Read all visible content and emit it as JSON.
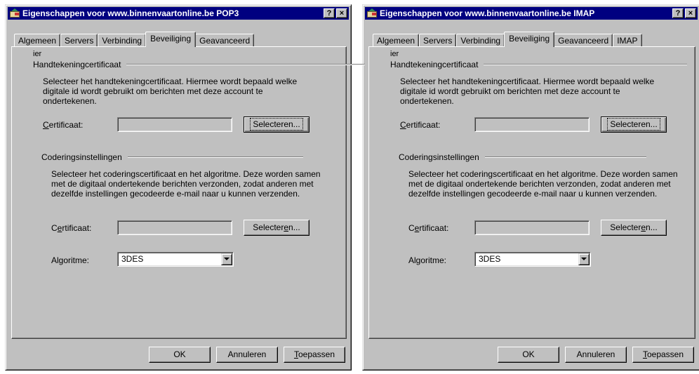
{
  "dialogs": [
    {
      "title": "Eigenschappen voor www.binnenvaartonline.be POP3",
      "title_buttons": [
        "?",
        "×"
      ],
      "tabs": [
        "Algemeen",
        "Servers",
        "Verbinding",
        "Beveiliging",
        "Geavanceerd"
      ],
      "active_tab": "Beveiliging",
      "stray_text": "ier",
      "signing": {
        "group_title": "Handtekeningcertificaat",
        "description": "Selecteer het handtekeningcertificaat. Hiermee wordt bepaald welke digitale id wordt gebruikt om berichten met deze account te ondertekenen.",
        "cert_label_u": "C",
        "cert_label_rest": "ertificaat:",
        "cert_value": "",
        "select_button": "Selecteren..."
      },
      "encryption": {
        "group_title": "Coderingsinstellingen",
        "description": "Selecteer het coderingscertificaat en het algoritme. Deze worden samen met de digitaal ondertekende berichten verzonden, zodat anderen met dezelfde instellingen gecodeerde e-mail naar u kunnen verzenden.",
        "cert_label_a": "C",
        "cert_label_u": "e",
        "cert_label_rest": "rtificaat:",
        "cert_value": "",
        "select_button_a": "Selecter",
        "select_button_u": "e",
        "select_button_rest": "n...",
        "algorithm_label": "Algoritme:",
        "algorithm_value": "3DES"
      },
      "buttons": {
        "ok": "OK",
        "cancel": "Annuleren",
        "apply_u": "T",
        "apply_rest": "oepassen"
      }
    },
    {
      "title": "Eigenschappen voor www.binnenvaartonline.be IMAP",
      "title_buttons": [
        "?",
        "×"
      ],
      "tabs": [
        "Algemeen",
        "Servers",
        "Verbinding",
        "Beveiliging",
        "Geavanceerd",
        "IMAP"
      ],
      "active_tab": "Beveiliging",
      "stray_text": "ier",
      "signing": {
        "group_title": "Handtekeningcertificaat",
        "description": "Selecteer het handtekeningcertificaat. Hiermee wordt bepaald welke digitale id wordt gebruikt om berichten met deze account te ondertekenen.",
        "cert_label_u": "C",
        "cert_label_rest": "ertificaat:",
        "cert_value": "",
        "select_button": "Selecteren..."
      },
      "encryption": {
        "group_title": "Coderingsinstellingen",
        "description": "Selecteer het coderingscertificaat en het algoritme. Deze worden samen met de digitaal ondertekende berichten verzonden, zodat anderen met dezelfde instellingen gecodeerde e-mail naar u kunnen verzenden.",
        "cert_label_a": "C",
        "cert_label_u": "e",
        "cert_label_rest": "rtificaat:",
        "cert_value": "",
        "select_button_a": "Selecter",
        "select_button_u": "e",
        "select_button_rest": "n...",
        "algorithm_label": "Algoritme:",
        "algorithm_value": "3DES"
      },
      "buttons": {
        "ok": "OK",
        "cancel": "Annuleren",
        "apply_u": "T",
        "apply_rest": "oepassen"
      }
    }
  ]
}
